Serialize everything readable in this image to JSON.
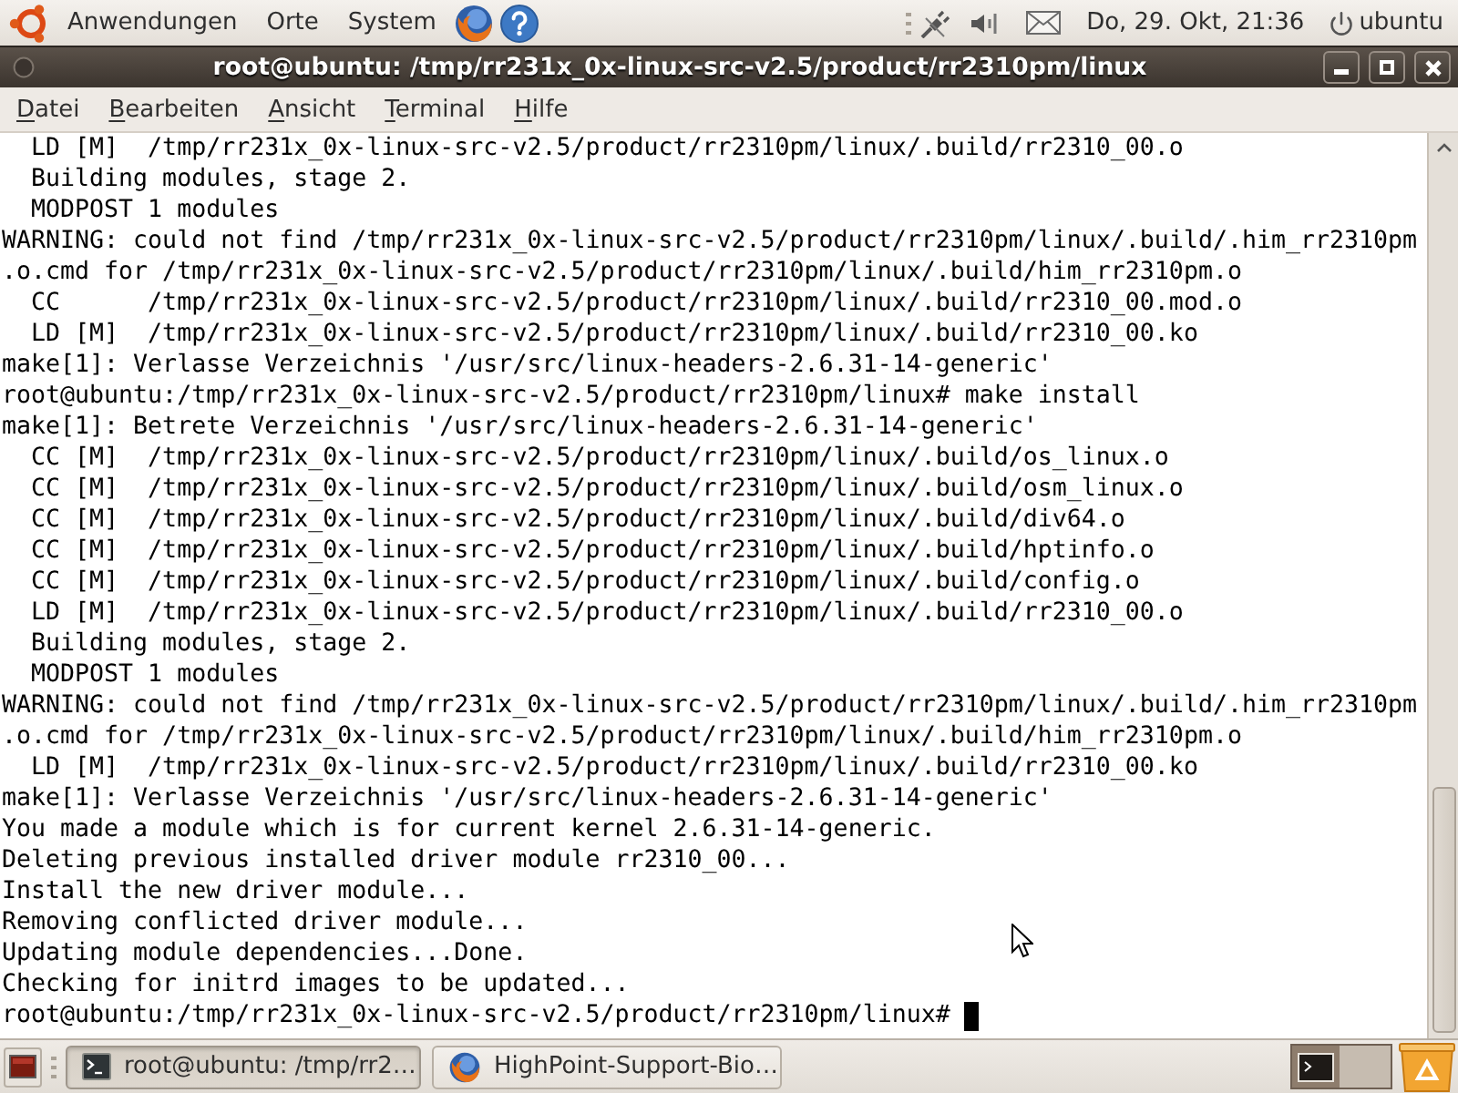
{
  "top_panel": {
    "menus": [
      "Anwendungen",
      "Orte",
      "System"
    ],
    "clock": "Do, 29. Okt, 21:36",
    "user": "ubuntu"
  },
  "window": {
    "title": "root@ubuntu: /tmp/rr231x_0x-linux-src-v2.5/product/rr2310pm/linux"
  },
  "menu_bar": [
    "Datei",
    "Bearbeiten",
    "Ansicht",
    "Terminal",
    "Hilfe"
  ],
  "terminal": {
    "lines": [
      "  LD [M]  /tmp/rr231x_0x-linux-src-v2.5/product/rr2310pm/linux/.build/rr2310_00.o",
      "  Building modules, stage 2.",
      "  MODPOST 1 modules",
      "WARNING: could not find /tmp/rr231x_0x-linux-src-v2.5/product/rr2310pm/linux/.build/.him_rr2310pm",
      ".o.cmd for /tmp/rr231x_0x-linux-src-v2.5/product/rr2310pm/linux/.build/him_rr2310pm.o",
      "  CC      /tmp/rr231x_0x-linux-src-v2.5/product/rr2310pm/linux/.build/rr2310_00.mod.o",
      "  LD [M]  /tmp/rr231x_0x-linux-src-v2.5/product/rr2310pm/linux/.build/rr2310_00.ko",
      "make[1]: Verlasse Verzeichnis '/usr/src/linux-headers-2.6.31-14-generic'",
      "root@ubuntu:/tmp/rr231x_0x-linux-src-v2.5/product/rr2310pm/linux# make install",
      "make[1]: Betrete Verzeichnis '/usr/src/linux-headers-2.6.31-14-generic'",
      "  CC [M]  /tmp/rr231x_0x-linux-src-v2.5/product/rr2310pm/linux/.build/os_linux.o",
      "  CC [M]  /tmp/rr231x_0x-linux-src-v2.5/product/rr2310pm/linux/.build/osm_linux.o",
      "  CC [M]  /tmp/rr231x_0x-linux-src-v2.5/product/rr2310pm/linux/.build/div64.o",
      "  CC [M]  /tmp/rr231x_0x-linux-src-v2.5/product/rr2310pm/linux/.build/hptinfo.o",
      "  CC [M]  /tmp/rr231x_0x-linux-src-v2.5/product/rr2310pm/linux/.build/config.o",
      "  LD [M]  /tmp/rr231x_0x-linux-src-v2.5/product/rr2310pm/linux/.build/rr2310_00.o",
      "  Building modules, stage 2.",
      "  MODPOST 1 modules",
      "WARNING: could not find /tmp/rr231x_0x-linux-src-v2.5/product/rr2310pm/linux/.build/.him_rr2310pm",
      ".o.cmd for /tmp/rr231x_0x-linux-src-v2.5/product/rr2310pm/linux/.build/him_rr2310pm.o",
      "  LD [M]  /tmp/rr231x_0x-linux-src-v2.5/product/rr2310pm/linux/.build/rr2310_00.ko",
      "make[1]: Verlasse Verzeichnis '/usr/src/linux-headers-2.6.31-14-generic'",
      "You made a module which is for current kernel 2.6.31-14-generic.",
      "Deleting previous installed driver module rr2310_00...",
      "Install the new driver module...",
      "Removing conflicted driver module...",
      "Updating module dependencies...Done.",
      "Checking for initrd images to be updated...",
      "root@ubuntu:/tmp/rr231x_0x-linux-src-v2.5/product/rr2310pm/linux#"
    ]
  },
  "taskbar": {
    "tasks": [
      {
        "label": "root@ubuntu: /tmp/rr2…",
        "kind": "terminal",
        "selected": true
      },
      {
        "label": "HighPoint-Support-Bio…",
        "kind": "browser",
        "selected": false
      }
    ],
    "workspaces": [
      {
        "selected": true,
        "window_shown": true
      },
      {
        "selected": false,
        "window_shown": false
      }
    ]
  }
}
